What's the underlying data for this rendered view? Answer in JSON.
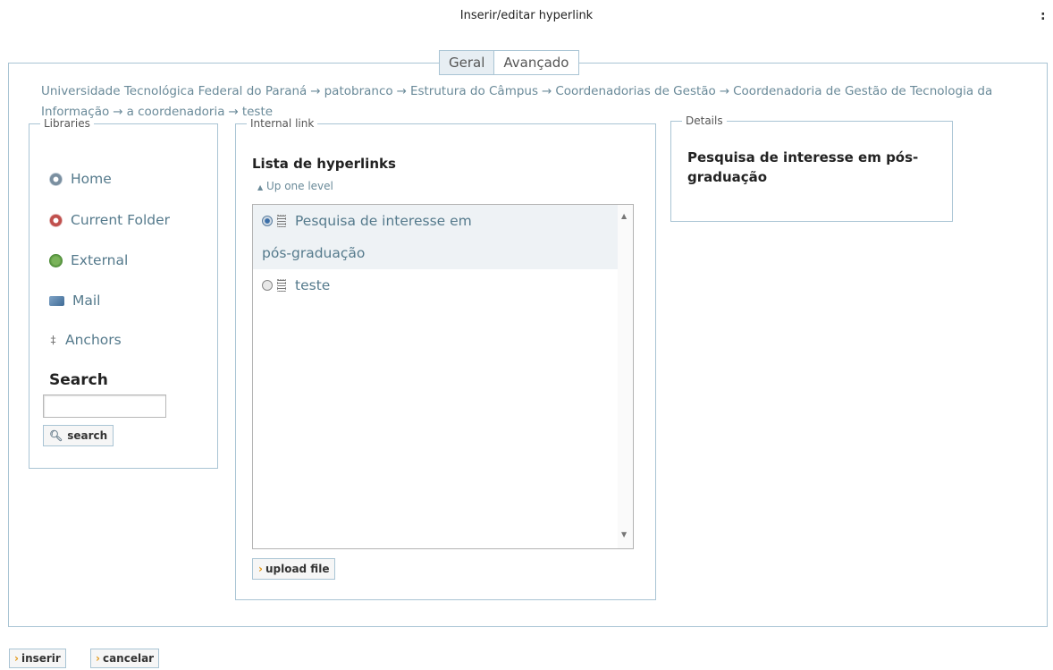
{
  "window": {
    "title": "Inserir/editar hyperlink",
    "close_mark": ":"
  },
  "tabs": [
    {
      "label": "Geral",
      "active": true
    },
    {
      "label": "Avançado",
      "active": false
    }
  ],
  "breadcrumb": {
    "items": [
      "Universidade Tecnológica Federal do Paraná",
      "patobranco",
      "Estrutura do Câmpus",
      "Coordenadorias de Gestão",
      "Coordenadoria de Gestão de Tecnologia da Informação",
      "a coordenadoria",
      "teste"
    ],
    "separator": "→"
  },
  "libraries": {
    "legend": "Libraries",
    "items": [
      {
        "label": "Home",
        "icon": "home-icon"
      },
      {
        "label": "Current Folder",
        "icon": "current-folder-icon"
      },
      {
        "label": "External",
        "icon": "globe-icon"
      },
      {
        "label": "Mail",
        "icon": "mail-icon"
      },
      {
        "label": "Anchors",
        "icon": "anchor-icon"
      }
    ],
    "search_label": "Search",
    "search_value": "",
    "search_button": "search"
  },
  "internal_link": {
    "legend": "Internal link",
    "title": "Lista de hyperlinks",
    "up_level": "Up one level",
    "items": [
      {
        "line1": "Pesquisa de interesse em",
        "line2": "pós-graduação",
        "selected": true
      },
      {
        "line1": "teste",
        "selected": false
      }
    ],
    "upload_button": "upload file"
  },
  "details": {
    "legend": "Details",
    "text": "Pesquisa de interesse em pós-graduação"
  },
  "footer": {
    "insert": "inserir",
    "cancel": "cancelar"
  },
  "colors": {
    "border": "#a9c4d4",
    "link": "#557a8c",
    "accent": "#e39a1c"
  }
}
